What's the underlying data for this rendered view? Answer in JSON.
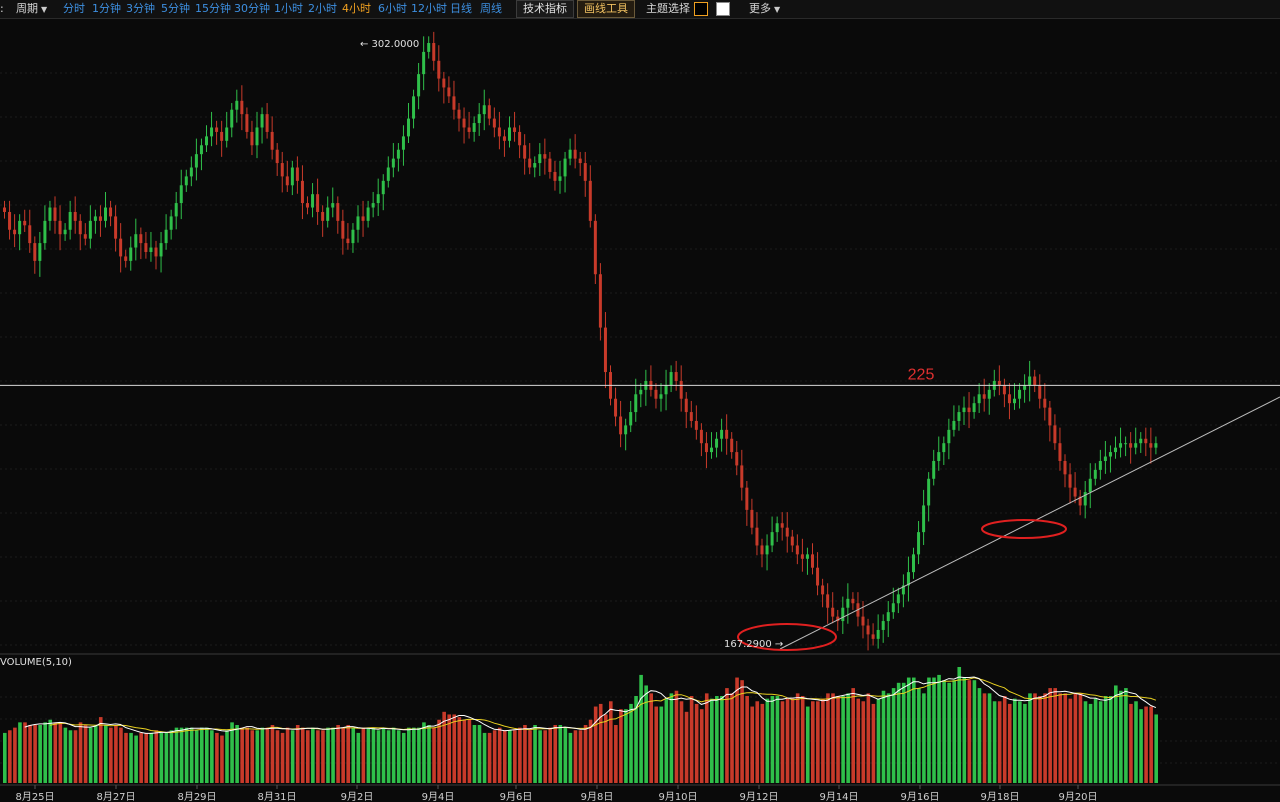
{
  "toolbar": {
    "period_label": "周期",
    "timeframes": [
      "分时",
      "1分钟",
      "3分钟",
      "5分钟",
      "15分钟",
      "30分钟",
      "1小时",
      "2小时",
      "4小时",
      "6小时",
      "12小时",
      "日线",
      "周线"
    ],
    "active_timeframe": "4小时",
    "indicators_button": "技术指标",
    "drawing_tools_button": "画线工具",
    "theme_label": "主题选择",
    "more_label": "更多",
    "theme_colors": [
      "#000000",
      "#ffffff"
    ]
  },
  "colors": {
    "up": "#2fbf4a",
    "down": "#c83a2a",
    "ma5": "#ffffff",
    "ma10": "#e8d020",
    "background": "#0a0a0a"
  },
  "chart_data": {
    "type": "candlestick",
    "price_max_label": "302.0000",
    "price_min_label": "167.2900",
    "annotation": "225",
    "annotation_value": 225,
    "horizontal_line_value": 225,
    "volume_label": "VOLUME(5,10)",
    "x_tick_labels": [
      "8月25日",
      "8月27日",
      "8月29日",
      "8月31日",
      "9月2日",
      "9月4日",
      "9月6日",
      "9月8日",
      "9月10日",
      "9月12日",
      "9月14日",
      "9月16日",
      "9月18日",
      "9月20日"
    ],
    "close_series": [
      264,
      260,
      259,
      262,
      261,
      257,
      253,
      257,
      262,
      265,
      262,
      259,
      260,
      264,
      262,
      259,
      258,
      262,
      263,
      262,
      265,
      263,
      258,
      254,
      253,
      256,
      259,
      257,
      255,
      256,
      254,
      257,
      260,
      263,
      266,
      270,
      272,
      274,
      277,
      279,
      281,
      283,
      282,
      280,
      283,
      287,
      289,
      286,
      282,
      279,
      283,
      286,
      282,
      278,
      275,
      272,
      270,
      274,
      271,
      266,
      265,
      268,
      264,
      262,
      265,
      266,
      262,
      258,
      257,
      260,
      263,
      262,
      265,
      266,
      268,
      271,
      274,
      276,
      278,
      281,
      285,
      290,
      295,
      300,
      302,
      298,
      294,
      292,
      290,
      287,
      285,
      283,
      282,
      284,
      286,
      288,
      285,
      283,
      281,
      280,
      283,
      282,
      279,
      276,
      274,
      275,
      277,
      276,
      273,
      271,
      272,
      276,
      278,
      276,
      275,
      271,
      262,
      250,
      238,
      228,
      222,
      218,
      214,
      216,
      219,
      223,
      224,
      226,
      224,
      222,
      223,
      225,
      228,
      226,
      222,
      219,
      217,
      215,
      212,
      210,
      211,
      213,
      215,
      213,
      210,
      207,
      202,
      197,
      193,
      189,
      187,
      189,
      192,
      194,
      193,
      191,
      189,
      187,
      186,
      187,
      184,
      180,
      178,
      175,
      173,
      172,
      175,
      177,
      176,
      173,
      171,
      169,
      168,
      170,
      172,
      174,
      176,
      178,
      180,
      183,
      187,
      192,
      198,
      204,
      208,
      210,
      212,
      215,
      217,
      219,
      220,
      219,
      221,
      223,
      222,
      224,
      226,
      225,
      223,
      221,
      222,
      224,
      225,
      227,
      225,
      222,
      220,
      216,
      212,
      208,
      205,
      202,
      200,
      198,
      201,
      204,
      206,
      208,
      209,
      210,
      211,
      212,
      212,
      211,
      212,
      213,
      212,
      211,
      212
    ],
    "volume_series": [
      19,
      20,
      21,
      23,
      23,
      22,
      22,
      22,
      23,
      24,
      23,
      23,
      21,
      20,
      20,
      23,
      22,
      21,
      22,
      25,
      22,
      21,
      22,
      21,
      19,
      19,
      18,
      19,
      19,
      19,
      20,
      19,
      19,
      20,
      21,
      21,
      21,
      21,
      20,
      21,
      21,
      20,
      19,
      18,
      20,
      23,
      22,
      21,
      21,
      20,
      20,
      21,
      21,
      22,
      20,
      19,
      21,
      20,
      22,
      21,
      20,
      21,
      20,
      20,
      21,
      21,
      22,
      21,
      22,
      21,
      19,
      21,
      21,
      21,
      20,
      21,
      20,
      21,
      20,
      19,
      21,
      21,
      21,
      23,
      22,
      21,
      24,
      27,
      26,
      26,
      25,
      24,
      24,
      22,
      22,
      19,
      19,
      20,
      21,
      20,
      20,
      20,
      21,
      22,
      20,
      22,
      20,
      20,
      21,
      22,
      22,
      21,
      19,
      20,
      20,
      22,
      24,
      29,
      30,
      26,
      31,
      22,
      28,
      28,
      30,
      33,
      41,
      37,
      34,
      29,
      29,
      32,
      34,
      35,
      31,
      27,
      33,
      30,
      28,
      34,
      32,
      33,
      33,
      36,
      34,
      40,
      39,
      33,
      29,
      31,
      30,
      32,
      33,
      33,
      31,
      32,
      32,
      34,
      33,
      29,
      31,
      31,
      32,
      34,
      34,
      33,
      33,
      34,
      36,
      32,
      31,
      34,
      30,
      32,
      35,
      34,
      36,
      38,
      38,
      40,
      40,
      36,
      34,
      40,
      40,
      41,
      39,
      38,
      39,
      44,
      40,
      39,
      39,
      36,
      34,
      34,
      31,
      31,
      33,
      30,
      32,
      31,
      30,
      34,
      34,
      33,
      34,
      36,
      36,
      34,
      34,
      32,
      34,
      34,
      31,
      30,
      32,
      31,
      33,
      33,
      37,
      35,
      36,
      30,
      31,
      28,
      29,
      29,
      26,
      25,
      29,
      27,
      28,
      26,
      25
    ]
  }
}
